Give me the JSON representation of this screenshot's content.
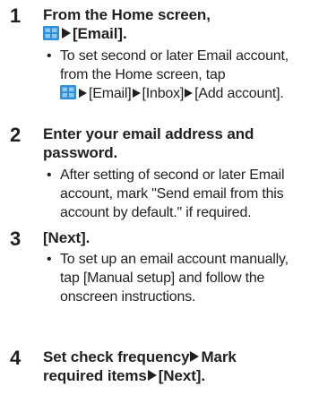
{
  "steps": [
    {
      "number": "1",
      "heading_lines": [
        "From the Home screen,",
        "[Email]."
      ],
      "note": [
        "To set second or later Email account,",
        "from the Home screen, tap",
        "[Email]",
        "[Inbox]",
        "[Add account]."
      ]
    },
    {
      "number": "2",
      "heading_lines": [
        "Enter your email address and",
        "password."
      ],
      "note": [
        "After setting of second or later Email",
        "account, mark \"Send email from this",
        "account by default.\" if required."
      ]
    },
    {
      "number": "3",
      "heading_lines": [
        "[Next]."
      ],
      "note": [
        "To set up an email account manually,",
        "tap [Manual setup] and follow the",
        "onscreen instructions."
      ]
    },
    {
      "number": "4",
      "heading_lines": [
        "Set check frequency",
        "Mark",
        "required items",
        "[Next]."
      ]
    }
  ],
  "bullet_char": "•",
  "icons": {
    "app": "apps-grid-icon",
    "arrow": "right-triangle-icon"
  },
  "colors": {
    "text": "#231f20",
    "icon_blue": "#2f8fd8",
    "icon_light": "#8fc9f2"
  }
}
